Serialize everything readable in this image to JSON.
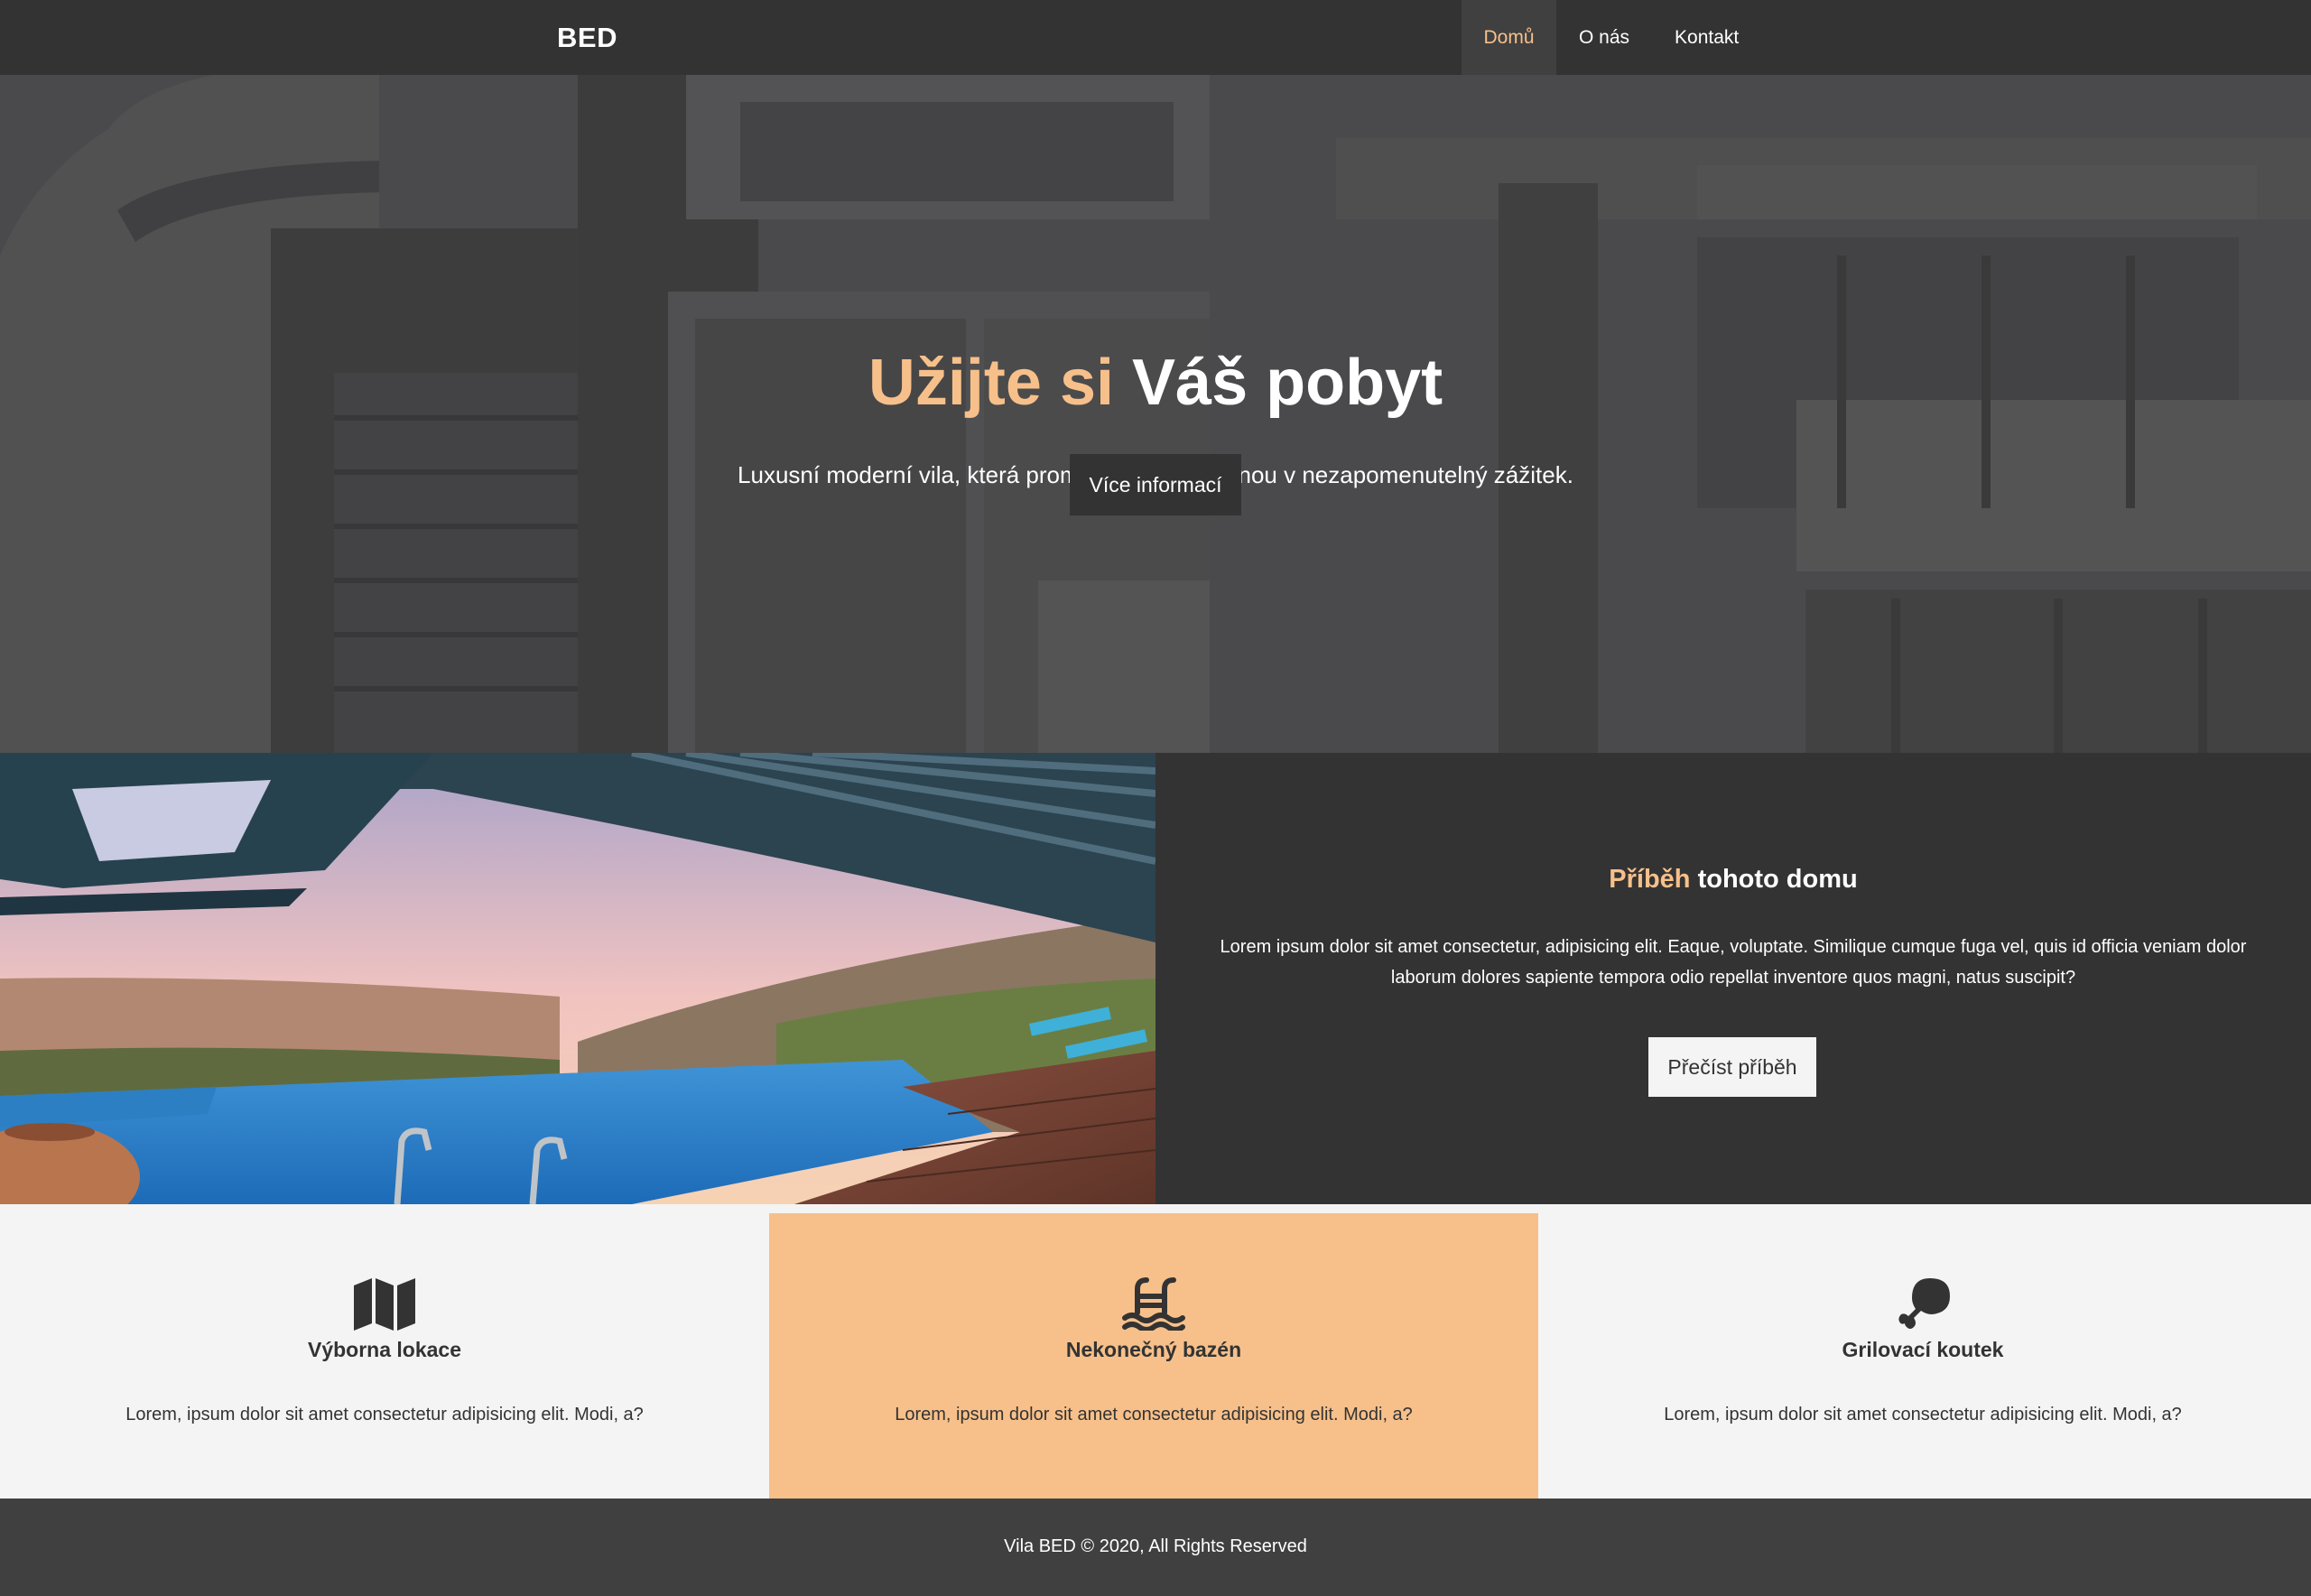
{
  "navbar": {
    "brand": "BED",
    "links": [
      {
        "label": "Domů",
        "active": true
      },
      {
        "label": "O nás",
        "active": false
      },
      {
        "label": "Kontakt",
        "active": false
      }
    ]
  },
  "hero": {
    "title_accent": "Užijte si",
    "title_rest": " Váš pobyt",
    "subtitle": "Luxusní moderní vila, která promění Vaši dovolenou v nezapomenutelný zážitek.",
    "button_label": "Více informací"
  },
  "story": {
    "title_accent": "Příběh",
    "title_rest": " tohoto domu",
    "text": "Lorem ipsum dolor sit amet consectetur, adipisicing elit. Eaque, voluptate. Similique cumque fuga vel, quis id officia veniam dolor laborum dolores sapiente tempora odio repellat inventore quos magni, natus suscipit?",
    "button_label": "Přečíst příběh"
  },
  "features": [
    {
      "icon": "map-icon",
      "title": "Výborna lokace",
      "text": "Lorem, ipsum dolor sit amet consectetur adipisicing elit. Modi, a?"
    },
    {
      "icon": "pool-icon",
      "title": "Nekonečný bazén",
      "text": "Lorem, ipsum dolor sit amet consectetur adipisicing elit. Modi, a?"
    },
    {
      "icon": "drumstick-icon",
      "title": "Grilovací koutek",
      "text": "Lorem, ipsum dolor sit amet consectetur adipisicing elit. Modi, a?"
    }
  ],
  "footer": {
    "text": "Vila BED © 2020, All Rights Reserved"
  },
  "colors": {
    "dark": "#333333",
    "accent": "#f7c08a",
    "light": "#f4f4f4",
    "footer": "#404040"
  }
}
